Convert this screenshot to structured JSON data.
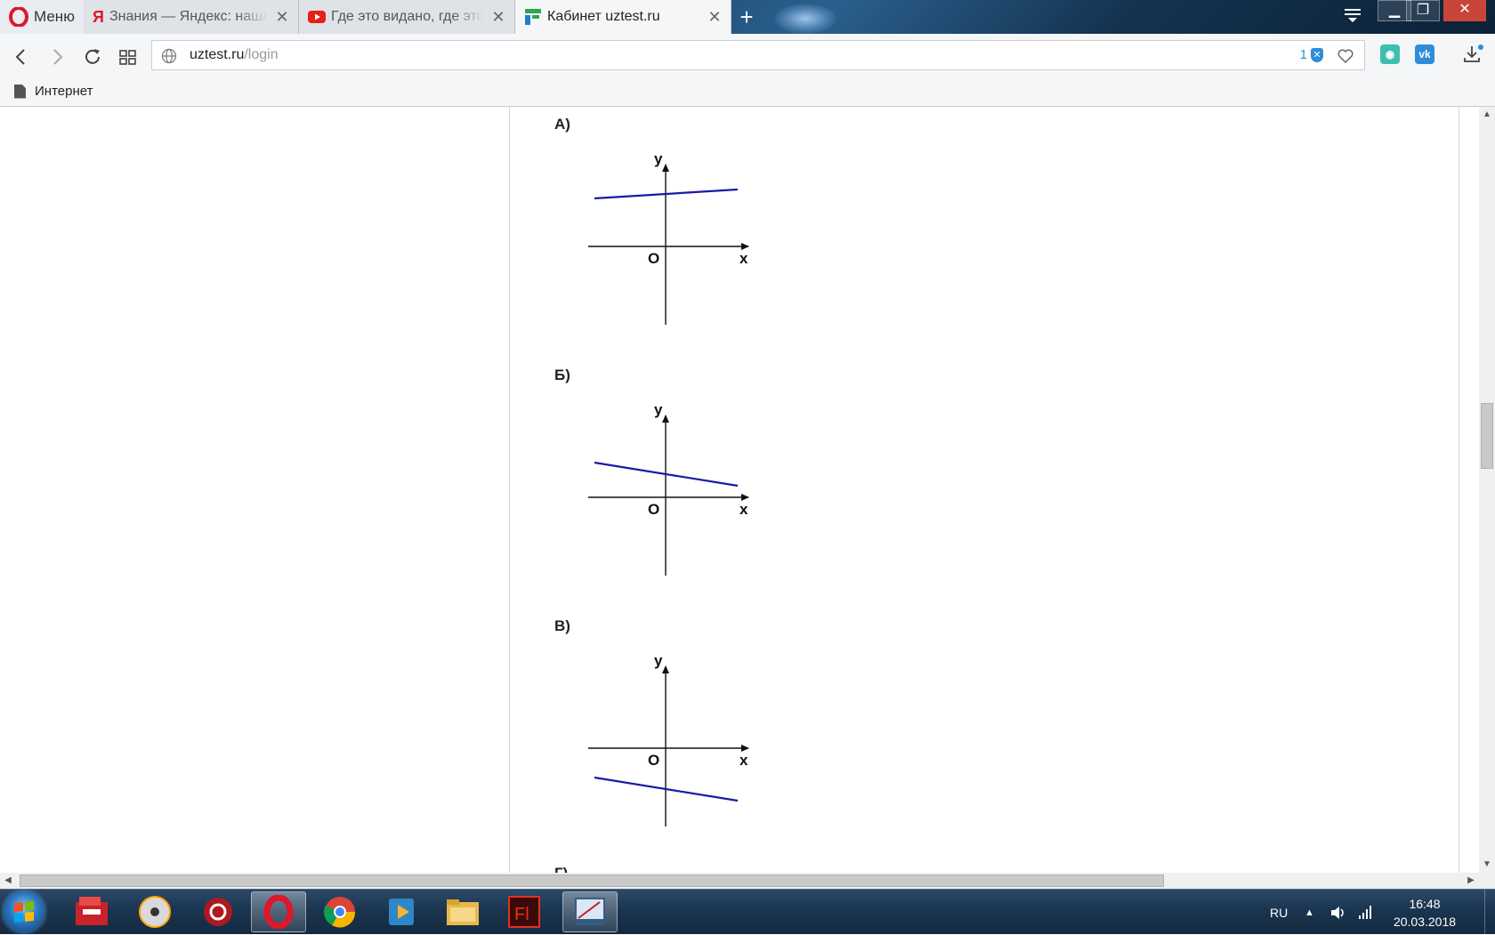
{
  "browser": {
    "menu_label": "Меню",
    "tabs": [
      {
        "title": "Знания — Яндекс: нашлось",
        "favicon": "yandex-icon",
        "active": false
      },
      {
        "title": "Где это видано, где это слыхано",
        "favicon": "youtube-icon",
        "active": false
      },
      {
        "title": "Кабинет uztest.ru",
        "favicon": "uztest-icon",
        "active": true
      }
    ],
    "address": {
      "host": "uztest.ru",
      "path": "/login"
    },
    "adblock_count": "1",
    "bookmark": "Интернет"
  },
  "page": {
    "options": [
      {
        "label": "А)",
        "line": {
          "intercept": "positive",
          "slope": "positive"
        }
      },
      {
        "label": "Б)",
        "line": {
          "intercept": "positive",
          "slope": "negative"
        }
      },
      {
        "label": "В)",
        "line": {
          "intercept": "negative",
          "slope": "negative"
        }
      }
    ],
    "next_option_label_partial": "Г)",
    "axis_labels": {
      "x": "x",
      "y": "y",
      "origin": "O"
    },
    "line_color": "#1a1aa6"
  },
  "taskbar": {
    "apps": [
      "toolbox-icon",
      "dvd-icon",
      "settings-gear-icon",
      "opera-icon",
      "chrome-icon",
      "media-player-icon",
      "folder-icon",
      "flash-icon",
      "presentation-icon"
    ],
    "active_app": "opera-icon",
    "language": "RU",
    "time": "16:48",
    "date": "20.03.2018"
  }
}
